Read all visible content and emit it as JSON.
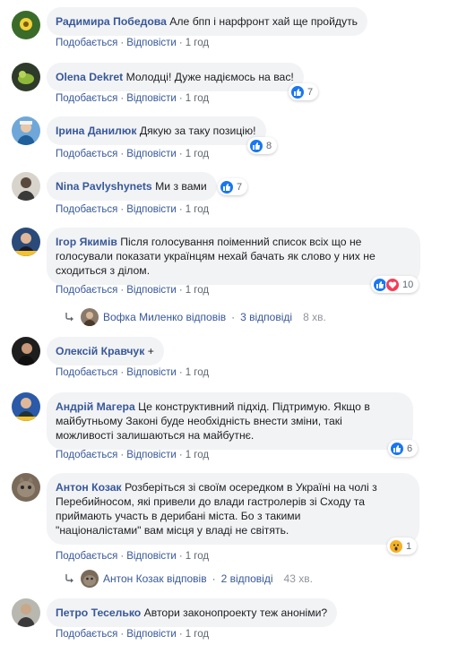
{
  "labels": {
    "like": "Подобається",
    "reply": "Відповісти",
    "sep": "·"
  },
  "comments": [
    {
      "author": "Радимира Победова",
      "text": "Але бпп і нарфронт хай ще пройдуть",
      "time": "1 год"
    },
    {
      "author": "Olena Dekret",
      "text": "Молодці! Дуже надіємось на вас!",
      "time": "1 год",
      "reaction_count": "7"
    },
    {
      "author": "Ірина Данилюк",
      "text": "Дякую за таку позицію!",
      "time": "1 год",
      "reaction_count": "8"
    },
    {
      "author": "Nina Pavlyshynets",
      "text": "Ми з вами",
      "time": "1 год",
      "reaction_count": "7"
    },
    {
      "author": "Ігор Якимів",
      "text_lines": [
        "Після голосування поіменний список всіх що не",
        "голосували показати українцям нехай бачать як слово у них не",
        "сходиться з ділом."
      ],
      "time": "1 год",
      "reaction_count": "10",
      "replies": {
        "replier": "Вофка Миленко",
        "action": "відповів",
        "count_text": "3 відповіді",
        "time": "8 хв."
      }
    },
    {
      "author": "Олексій Кравчук",
      "text": "+",
      "time": "1 год"
    },
    {
      "author": "Андрій Магера",
      "text_lines": [
        "Це конструктивний підхід. Підтримую. Якщо в",
        "майбутньому Законі буде необхідність внести зміни, такі",
        "можливості залишаються на майбутнє."
      ],
      "time": "1 год",
      "reaction_count": "6"
    },
    {
      "author": "Антон Козак",
      "text_lines": [
        "Розберіться зі своїм осередком в Україні на чолі з",
        "Перебийносом, які привели до влади гастролерів зі Сходу та",
        "приймають участь в дерибані міста. Бо з такими",
        "\"націоналістами\" вам місця у владі не світять."
      ],
      "time": "1 год",
      "reaction_count": "1",
      "replies": {
        "replier": "Антон Козак",
        "action": "відповів",
        "count_text": "2 відповіді",
        "time": "43 хв."
      }
    },
    {
      "author": "Петро Теселько",
      "text": "Автори законопроекту теж аноніми?",
      "time": "1 год"
    }
  ],
  "colors": {
    "link": "#385898",
    "bubble": "#f2f3f5",
    "like_blue": "#1877f2",
    "love_red": "#f33e58",
    "wow_yellow": "#f7b125"
  }
}
